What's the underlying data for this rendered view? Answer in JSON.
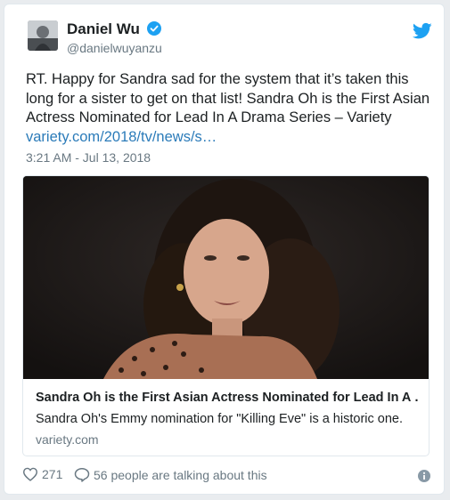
{
  "author": {
    "display_name": "Daniel Wu",
    "handle": "@danielwuyanzu",
    "avatar_icon": "avatar-photo",
    "verified_icon": "verified-badge-icon"
  },
  "tweet": {
    "text": "RT. Happy for Sandra sad for the system that it’s taken this long for a sister to get on that list! Sandra Oh is the First Asian Actress Nominated for Lead In A Drama Series – Variety",
    "link": "variety.com/2018/tv/news/s…",
    "timestamp": "3:21 AM - Jul 13, 2018"
  },
  "card": {
    "title": "Sandra Oh is the First Asian Actress Nominated for Lead In A …",
    "description": "Sandra Oh's Emmy nomination for \"Killing Eve\" is a historic one.",
    "domain": "variety.com"
  },
  "footer": {
    "likes": "271",
    "conversation": "56 people are talking about this"
  },
  "colors": {
    "link": "#2b7bb9",
    "twitter_blue": "#1da1f2",
    "secondary_text": "#697882"
  }
}
